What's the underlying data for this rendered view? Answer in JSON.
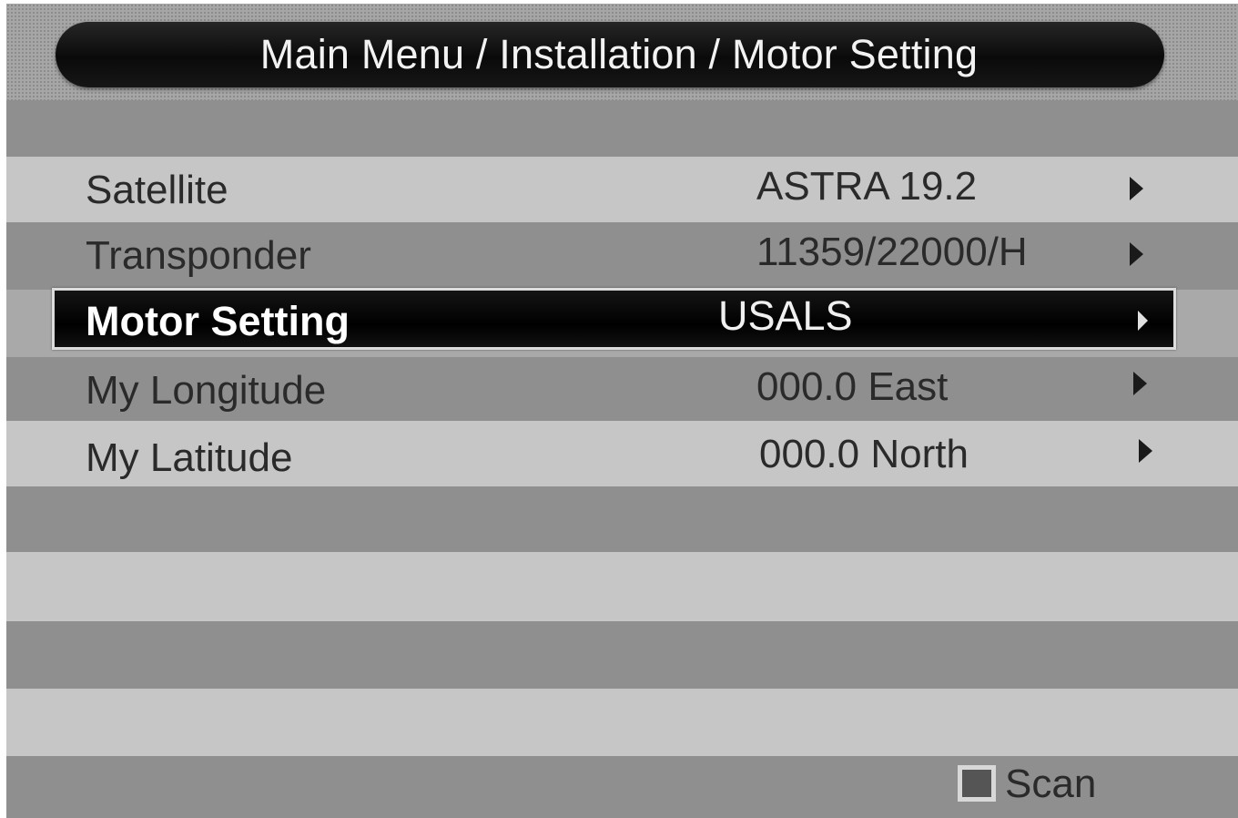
{
  "header": {
    "breadcrumb": "Main Menu / Installation / Motor Setting"
  },
  "menu": {
    "items": [
      {
        "label": "Satellite",
        "value": "ASTRA 19.2"
      },
      {
        "label": "Transponder",
        "value": "11359/22000/H"
      },
      {
        "label": "Motor Setting",
        "value": "USALS",
        "selected": true
      },
      {
        "label": "My Longitude",
        "value": "000.0 East"
      },
      {
        "label": "My Latitude",
        "value": "000.0 North"
      }
    ]
  },
  "footer": {
    "scan_label": "Scan",
    "scan_key_color": "#555555"
  },
  "colors": {
    "title_bar": "#0a0a0a",
    "selected_row": "#000000",
    "stripe_light": "#c6c6c6",
    "stripe_dark": "#8f8f8f"
  }
}
